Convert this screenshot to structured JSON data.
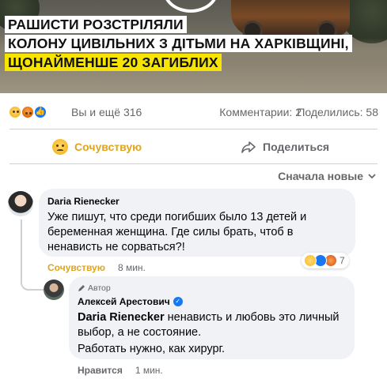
{
  "post": {
    "headline": {
      "line1": "РАШИСТИ РОЗСТРІЛЯЛИ",
      "line2": "КОЛОНУ ЦИВІЛЬНИХ З ДІТЬМИ НА ХАРКІВЩИНІ,",
      "line3": "ЩОНАЙМЕНШЕ 20 ЗАГИБЛИХ"
    }
  },
  "reactions": {
    "icons": [
      "care-emoji",
      "angry-emoji",
      "like-emoji"
    ],
    "summary": "Вы и ещё 316",
    "comments": "Комментарии: 2",
    "shares": "Поделились: 58"
  },
  "actions": {
    "care_label": "Сочувствую",
    "share_label": "Поделиться"
  },
  "sort": {
    "label": "Сначала новые"
  },
  "comments": [
    {
      "author": "Daria Rienecker",
      "text": "Уже пишут, что среди погибших было 13 детей и беременная женщина. Где силы брать, чтоб в ненависть не сорваться?!",
      "react_label": "Сочувствую",
      "time": "8 мин.",
      "reaction_count": "7"
    },
    {
      "badge": "Автор",
      "author": "Алексей Арестович",
      "mention": "Daria Rienecker",
      "text_p1": "ненависть и любовь это личный выбор, а не состояние.",
      "text_p2": "Работать нужно, как хирург.",
      "like_label": "Нравится",
      "time": "1 мин."
    }
  ],
  "colors": {
    "care": "#e0a51c",
    "muted": "#65676b",
    "bubble": "#f0f2f5",
    "highlight": "#f7e500",
    "accent": "#1877f2"
  }
}
